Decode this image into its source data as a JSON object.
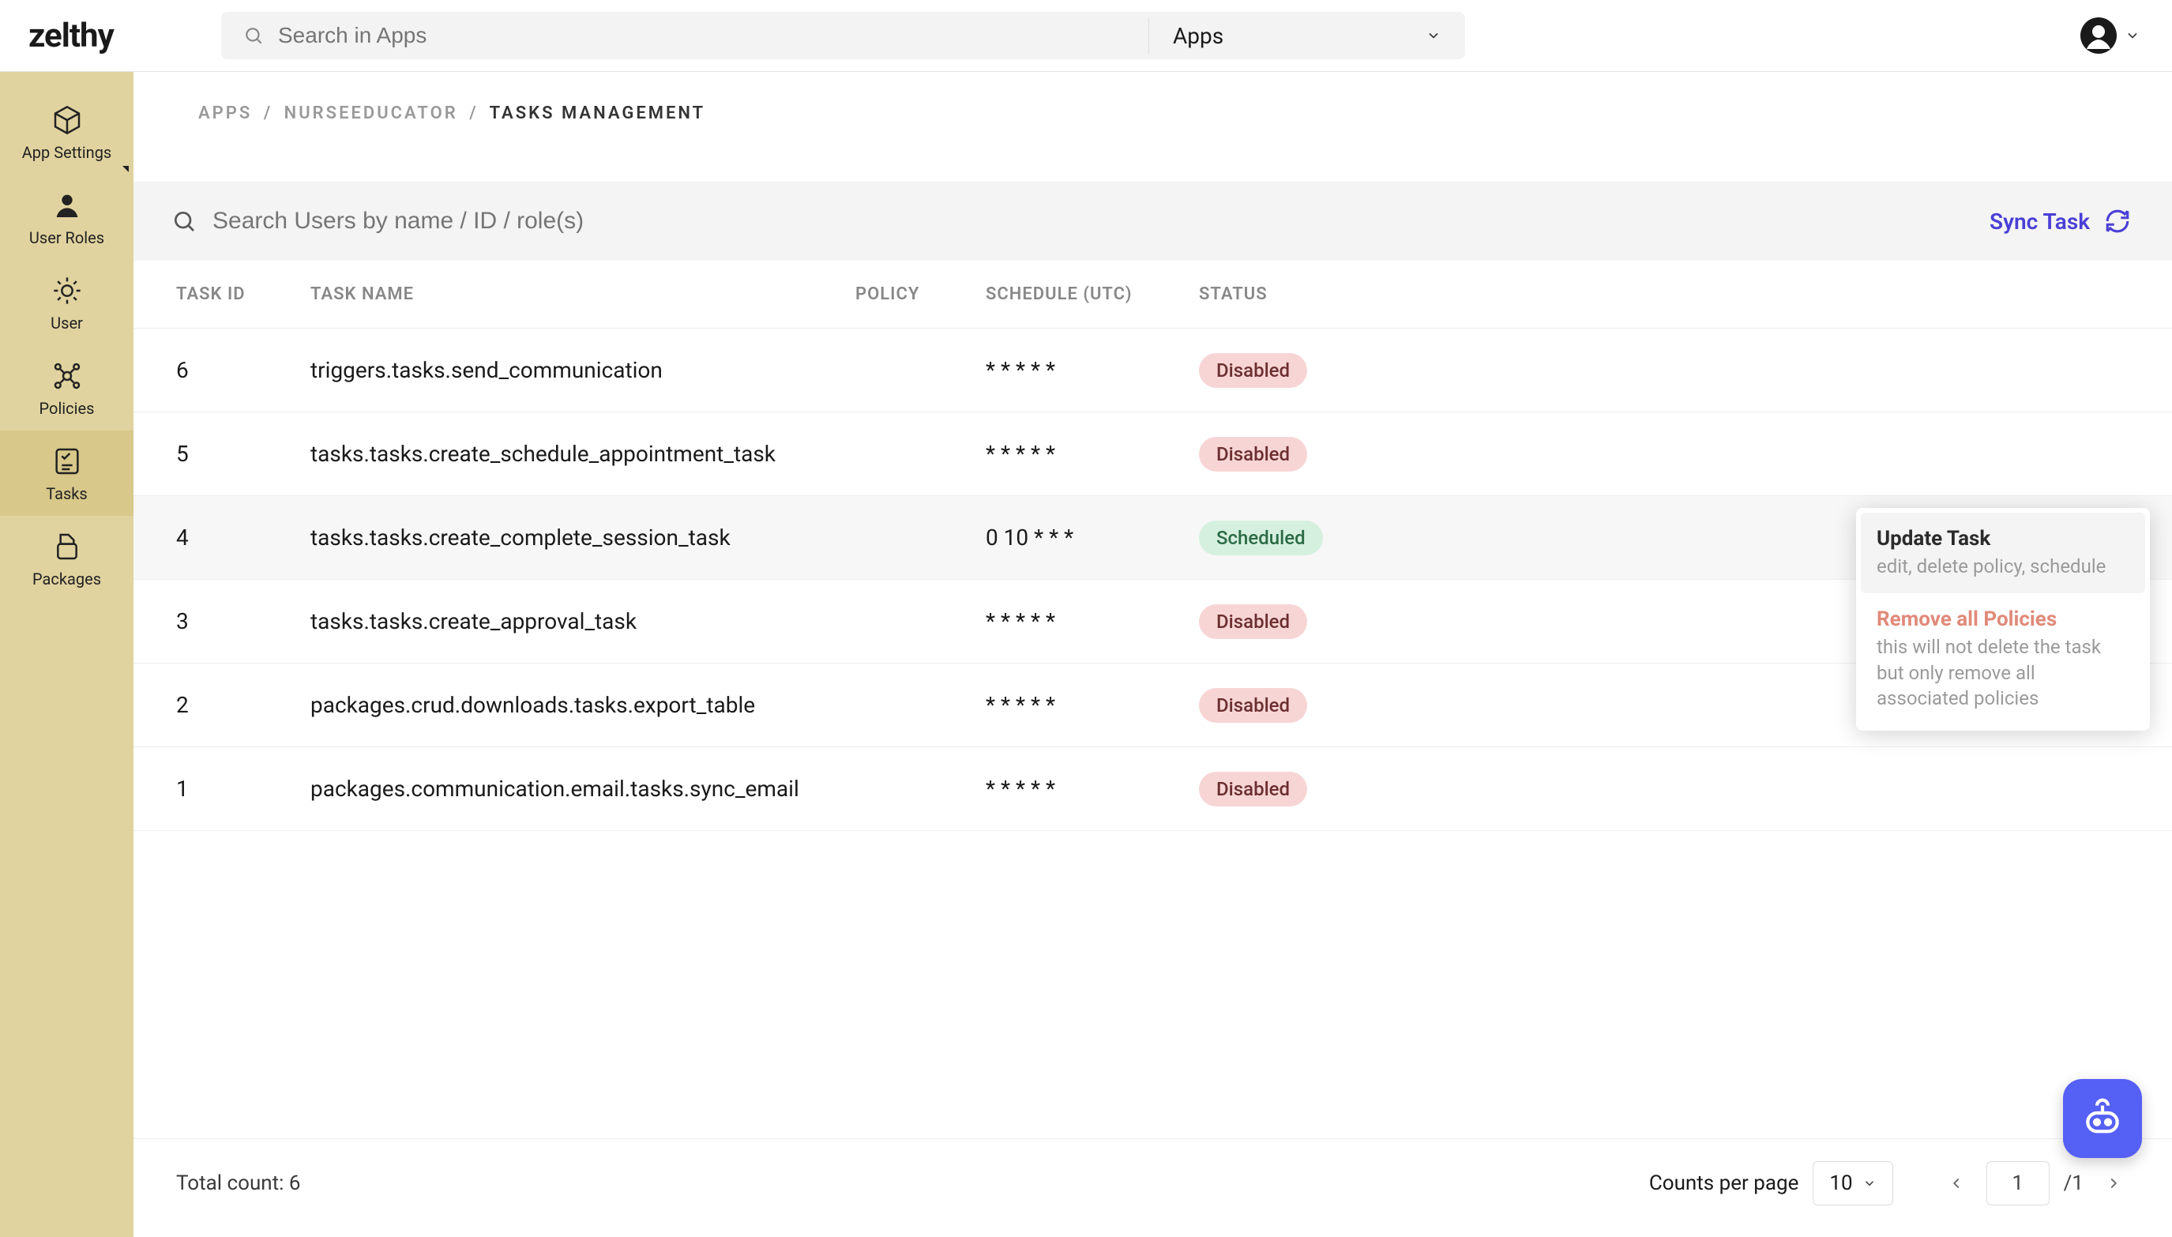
{
  "logo": "zelthy",
  "search": {
    "placeholder": "Search in Apps",
    "dropdown": "Apps"
  },
  "breadcrumb": {
    "apps": "APPS",
    "app_name": "NURSEEDUCATOR",
    "page": "TASKS MANAGEMENT"
  },
  "sidebar": {
    "items": [
      {
        "label": "App Settings"
      },
      {
        "label": "User Roles"
      },
      {
        "label": "User"
      },
      {
        "label": "Policies"
      },
      {
        "label": "Tasks"
      },
      {
        "label": "Packages"
      }
    ]
  },
  "filter": {
    "placeholder": "Search Users by name / ID / role(s)",
    "sync": "Sync Task"
  },
  "columns": {
    "id": "TASK ID",
    "name": "TASK NAME",
    "policy": "POLICY",
    "schedule": "SCHEDULE (UTC)",
    "status": "STATUS"
  },
  "rows": [
    {
      "id": "6",
      "name": "triggers.tasks.send_communication",
      "policy": "",
      "schedule": "* * * * *",
      "status": "Disabled",
      "status_type": "disabled"
    },
    {
      "id": "5",
      "name": "tasks.tasks.create_schedule_appointment_task",
      "policy": "",
      "schedule": "* * * * *",
      "status": "Disabled",
      "status_type": "disabled"
    },
    {
      "id": "4",
      "name": "tasks.tasks.create_complete_session_task",
      "policy": "",
      "schedule": "0 10 * * *",
      "status": "Scheduled",
      "status_type": "scheduled"
    },
    {
      "id": "3",
      "name": "tasks.tasks.create_approval_task",
      "policy": "",
      "schedule": "* * * * *",
      "status": "Disabled",
      "status_type": "disabled"
    },
    {
      "id": "2",
      "name": "packages.crud.downloads.tasks.export_table",
      "policy": "",
      "schedule": "* * * * *",
      "status": "Disabled",
      "status_type": "disabled"
    },
    {
      "id": "1",
      "name": "packages.communication.email.tasks.sync_email",
      "policy": "",
      "schedule": "* * * * *",
      "status": "Disabled",
      "status_type": "disabled"
    }
  ],
  "dropdown": {
    "update": {
      "title": "Update Task",
      "sub": "edit, delete policy, schedule"
    },
    "remove": {
      "title": "Remove all Policies",
      "sub": "this will not delete the task but only remove all associated policies"
    }
  },
  "footer": {
    "total_label": "Total count: ",
    "total_value": "6",
    "cpp_label": "Counts per page",
    "cpp_value": "10",
    "page_value": "1",
    "page_sep": "/",
    "page_total": "1"
  }
}
